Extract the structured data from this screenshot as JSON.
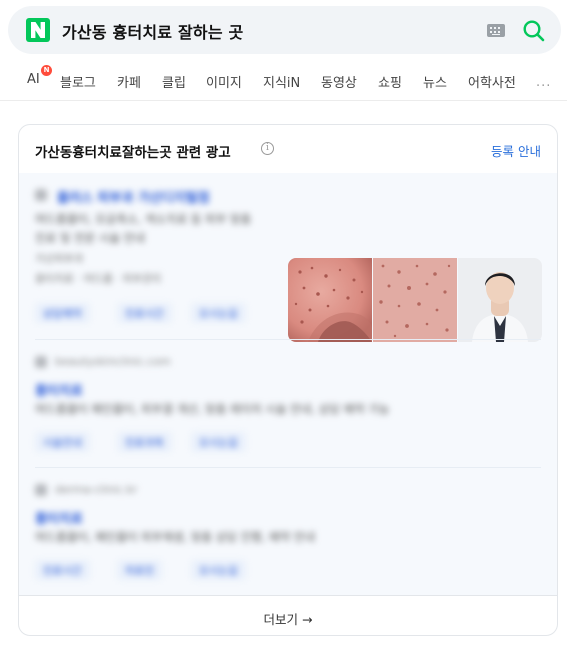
{
  "search": {
    "query": "가산동 흉터치료 잘하는 곳"
  },
  "tabs": [
    {
      "label": "AI",
      "badge": "N"
    },
    {
      "label": "블로그"
    },
    {
      "label": "카페"
    },
    {
      "label": "클립"
    },
    {
      "label": "이미지"
    },
    {
      "label": "지식iN"
    },
    {
      "label": "동영상"
    },
    {
      "label": "쇼핑"
    },
    {
      "label": "뉴스"
    },
    {
      "label": "어학사전"
    }
  ],
  "more_tabs": "···",
  "ad_section": {
    "title": "가산동흉터치료잘하는곳 관련 광고",
    "info_icon": "i",
    "register_link": "등록 안내",
    "more_label": "더보기 →",
    "ads": [
      {
        "title": "플러스 피부과 가산디지털점",
        "desc_1": "여드름흉터, 모공축소, 색소치료 등 피부 맞춤",
        "desc_2": "진료 및 전문 시술 안내",
        "site": "가산피부과",
        "tagline": "흉터치료 · 여드름 · 피부관리",
        "chips": [
          "상담예약",
          "진료시간",
          "오시는길"
        ]
      },
      {
        "site": "beautyskinclinic.com",
        "title": "흉터치료",
        "desc": "여드름흉터 패인흉터, 피부결 개선, 맞춤 레이저 시술 안내, 상담 예약 가능",
        "chips": [
          "시술안내",
          "진료과목",
          "오시는길"
        ]
      },
      {
        "site": "derma-clinic.kr",
        "title": "흉터치료",
        "desc": "여드름흉터, 패인흉터 피부재생, 맞춤 상담 진행, 예약 안내",
        "chips": [
          "진료시간",
          "의료진",
          "오시는길"
        ]
      }
    ]
  }
}
